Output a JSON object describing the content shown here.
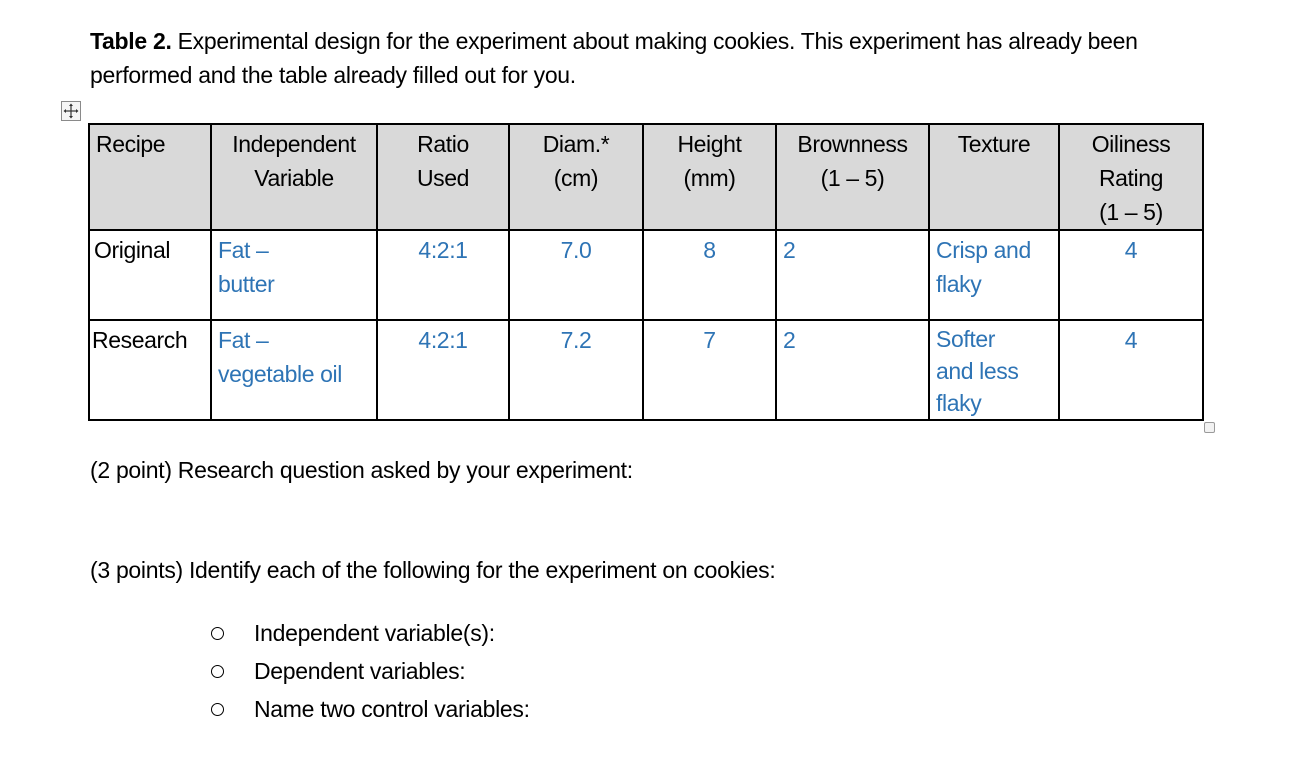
{
  "caption": {
    "label": "Table 2.",
    "text": " Experimental design for the experiment about making cookies. This experiment has already been performed and the table already filled out for you."
  },
  "table": {
    "headers": [
      "Recipe",
      "Independent Variable",
      "Ratio Used",
      "Diam.* (cm)",
      "Height (mm)",
      "Brownness (1 – 5)",
      "Texture",
      "Oiliness Rating (1 – 5)"
    ],
    "header_lines": [
      [
        "Recipe"
      ],
      [
        "Independent",
        "Variable"
      ],
      [
        "Ratio",
        "Used"
      ],
      [
        "Diam.*",
        "(cm)"
      ],
      [
        "Height",
        "(mm)"
      ],
      [
        "Brownness",
        "(1 – 5)"
      ],
      [
        "Texture"
      ],
      [
        "Oiliness",
        "Rating",
        "(1 – 5)"
      ]
    ],
    "rows": [
      {
        "recipe": "Original",
        "independent_variable": "Fat – butter",
        "iv_lines": [
          "Fat –",
          "butter"
        ],
        "ratio": "4:2:1",
        "diameter": "7.0",
        "height": "8",
        "brownness": "2",
        "texture": "Crisp and flaky",
        "texture_lines": [
          "Crisp and",
          "flaky"
        ],
        "oiliness": "4"
      },
      {
        "recipe": "Research",
        "independent_variable": "Fat – vegetable oil",
        "iv_lines": [
          "Fat –",
          "vegetable oil"
        ],
        "ratio": "4:2:1",
        "diameter": "7.2",
        "height": "7",
        "brownness": "2",
        "texture": "Softer and less flaky",
        "texture_lines": [
          "Softer",
          "and less",
          "flaky"
        ],
        "oiliness": "4"
      }
    ],
    "data_text_color": "#2e74b5",
    "header_bg_color": "#d9d9d9"
  },
  "questions": {
    "research_question": "(2 point) Research question asked by your experiment:",
    "identify": "(3 points) Identify each of the following for the experiment on cookies:",
    "bullets": [
      "Independent variable(s):",
      "Dependent variables:",
      "Name two control variables:"
    ]
  },
  "icons": {
    "table_move_handle": "move-arrows-icon",
    "table_resize_handle": "resize-square-icon",
    "bullet": "hollow-circle-bullet"
  }
}
